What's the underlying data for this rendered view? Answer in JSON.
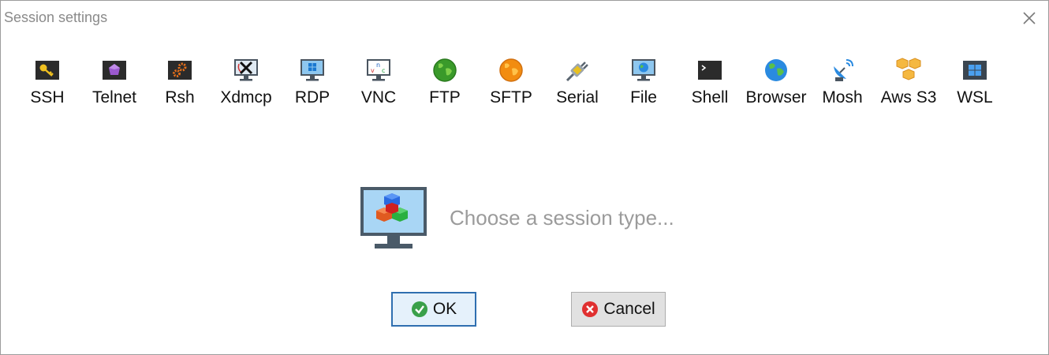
{
  "window": {
    "title": "Session settings"
  },
  "session_types": [
    {
      "label": "SSH",
      "icon": "ssh-key-icon"
    },
    {
      "label": "Telnet",
      "icon": "telnet-gem-icon"
    },
    {
      "label": "Rsh",
      "icon": "rsh-gears-icon"
    },
    {
      "label": "Xdmcp",
      "icon": "xdmcp-monitor-icon"
    },
    {
      "label": "RDP",
      "icon": "rdp-monitor-icon"
    },
    {
      "label": "VNC",
      "icon": "vnc-monitor-icon"
    },
    {
      "label": "FTP",
      "icon": "ftp-globe-icon"
    },
    {
      "label": "SFTP",
      "icon": "sftp-globe-icon"
    },
    {
      "label": "Serial",
      "icon": "serial-plug-icon"
    },
    {
      "label": "File",
      "icon": "file-monitor-icon"
    },
    {
      "label": "Shell",
      "icon": "shell-terminal-icon"
    },
    {
      "label": "Browser",
      "icon": "browser-globe-icon"
    },
    {
      "label": "Mosh",
      "icon": "mosh-satellite-icon"
    },
    {
      "label": "Aws S3",
      "icon": "aws-s3-cubes-icon"
    },
    {
      "label": "WSL",
      "icon": "wsl-windows-icon"
    }
  ],
  "main": {
    "placeholder": "Choose a session type..."
  },
  "buttons": {
    "ok": "OK",
    "cancel": "Cancel"
  }
}
